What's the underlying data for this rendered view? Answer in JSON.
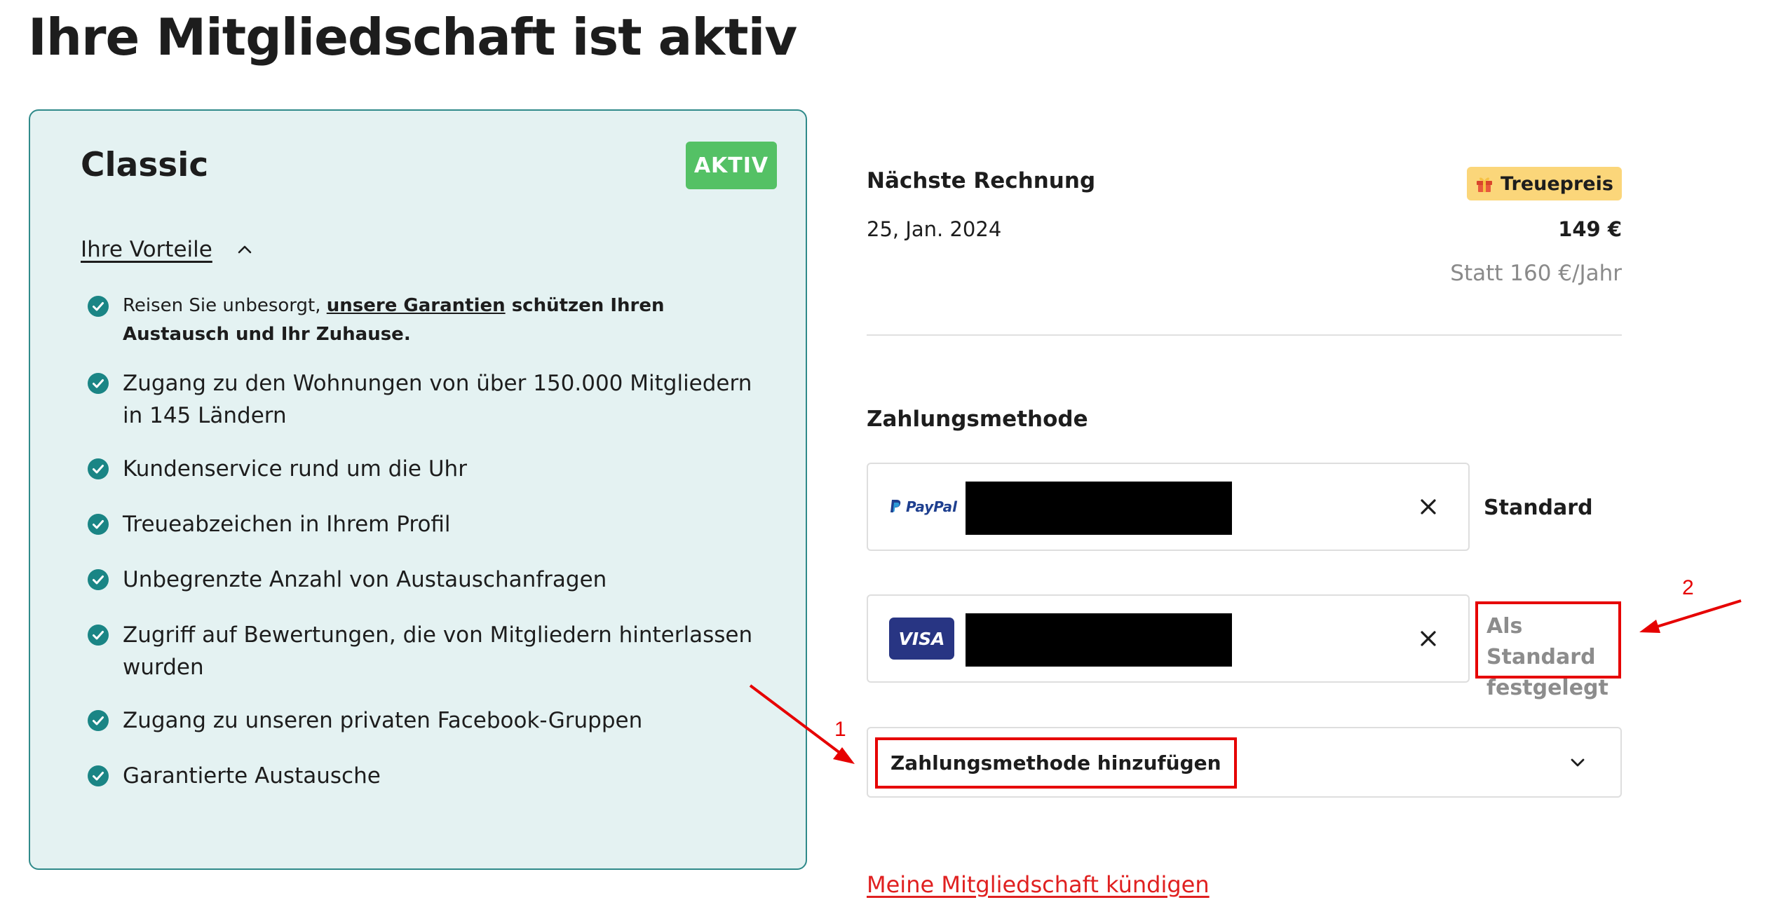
{
  "page": {
    "title": "Ihre Mitgliedschaft ist aktiv"
  },
  "plan": {
    "name": "Classic",
    "status_badge": "AKTIV",
    "benefits_toggle": "Ihre Vorteile",
    "benefits_first": {
      "prefix": "Reisen Sie unbesorgt, ",
      "link": "unsere Garantien",
      "suffix": " schützen Ihren Austausch und Ihr Zuhause."
    },
    "benefits": [
      "Zugang zu den Wohnungen von über 150.000 Mitgliedern in 145 Ländern",
      "Kundenservice rund um die Uhr",
      "Treueabzeichen in Ihrem Profil",
      "Unbegrenzte Anzahl von Austauschanfragen",
      "Zugriff auf Bewertungen, die von Mitgliedern hinterlassen wurden",
      "Zugang zu unseren privaten Facebook-Gruppen",
      "Garantierte Austausche"
    ]
  },
  "invoice": {
    "title": "Nächste Rechnung",
    "badge": "Treuepreis",
    "date": "25, Jan. 2024",
    "price": "149 €",
    "original_price": "Statt 160 €/Jahr"
  },
  "payment": {
    "title": "Zahlungsmethode",
    "methods": [
      {
        "brand": "PayPal",
        "status": "Standard"
      },
      {
        "brand": "VISA",
        "status": "Als Standard festgelegt"
      }
    ],
    "add_label": "Zahlungsmethode hinzufügen"
  },
  "cancel_link": "Meine Mitgliedschaft kündigen",
  "annotations": {
    "marker_1": "1",
    "marker_2": "2",
    "color": "#e60000"
  },
  "colors": {
    "card_bg": "#e4f2f2",
    "card_border": "#2f8a8a",
    "active_badge": "#54c165",
    "check": "#1a8585",
    "loyalty_badge": "#fbd67a",
    "visa_bg": "#283583",
    "cancel_link": "#e02020"
  }
}
